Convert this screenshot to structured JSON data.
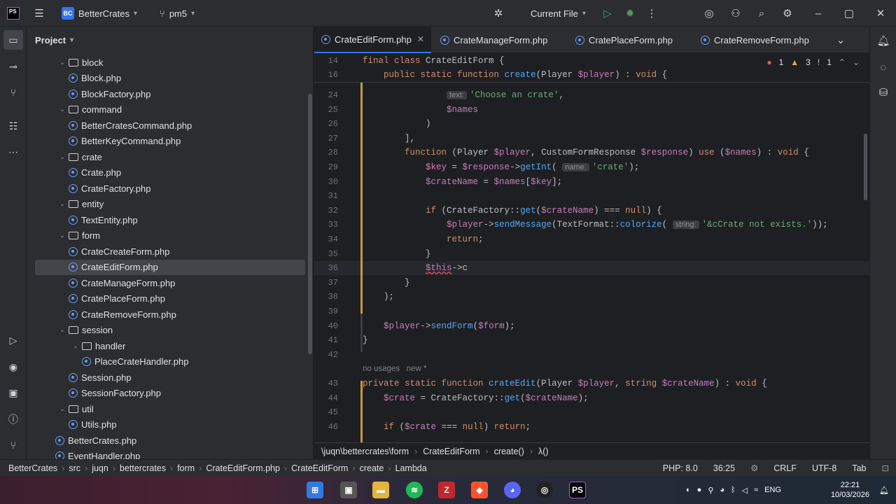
{
  "titlebar": {
    "project_badge": "BC",
    "project_name": "BetterCrates",
    "branch": "pm5",
    "run_config": "Current File"
  },
  "sidebar": {
    "header": "Project",
    "items": [
      {
        "label": "block",
        "type": "folder",
        "depth": 1,
        "open": true
      },
      {
        "label": "Block.php",
        "type": "file",
        "depth": 2
      },
      {
        "label": "BlockFactory.php",
        "type": "file",
        "depth": 2
      },
      {
        "label": "command",
        "type": "folder",
        "depth": 1,
        "open": true
      },
      {
        "label": "BetterCratesCommand.php",
        "type": "file",
        "depth": 2
      },
      {
        "label": "BetterKeyCommand.php",
        "type": "file",
        "depth": 2
      },
      {
        "label": "crate",
        "type": "folder",
        "depth": 1,
        "open": true
      },
      {
        "label": "Crate.php",
        "type": "file",
        "depth": 2
      },
      {
        "label": "CrateFactory.php",
        "type": "file",
        "depth": 2
      },
      {
        "label": "entity",
        "type": "folder",
        "depth": 1,
        "open": true
      },
      {
        "label": "TextEntity.php",
        "type": "file",
        "depth": 2
      },
      {
        "label": "form",
        "type": "folder",
        "depth": 1,
        "open": true
      },
      {
        "label": "CrateCreateForm.php",
        "type": "file",
        "depth": 2
      },
      {
        "label": "CrateEditForm.php",
        "type": "file",
        "depth": 2,
        "selected": true
      },
      {
        "label": "CrateManageForm.php",
        "type": "file",
        "depth": 2
      },
      {
        "label": "CratePlaceForm.php",
        "type": "file",
        "depth": 2
      },
      {
        "label": "CrateRemoveForm.php",
        "type": "file",
        "depth": 2
      },
      {
        "label": "session",
        "type": "folder",
        "depth": 1,
        "open": true
      },
      {
        "label": "handler",
        "type": "folder",
        "depth": 2,
        "open": true
      },
      {
        "label": "PlaceCrateHandler.php",
        "type": "file",
        "depth": 3
      },
      {
        "label": "Session.php",
        "type": "file",
        "depth": 2
      },
      {
        "label": "SessionFactory.php",
        "type": "file",
        "depth": 2
      },
      {
        "label": "util",
        "type": "folder",
        "depth": 1,
        "open": true
      },
      {
        "label": "Utils.php",
        "type": "file",
        "depth": 2
      },
      {
        "label": "BetterCrates.php",
        "type": "file",
        "depth": 1
      },
      {
        "label": "EventHandler.php",
        "type": "file",
        "depth": 1
      }
    ]
  },
  "tabs": [
    {
      "label": "CrateEditForm.php",
      "active": true
    },
    {
      "label": "CrateManageForm.php"
    },
    {
      "label": "CratePlaceForm.php"
    },
    {
      "label": "CrateRemoveForm.php"
    }
  ],
  "problems": {
    "errors": "1",
    "warnings": "3",
    "infos": "1"
  },
  "editor": {
    "sticky": [
      {
        "ln": "14",
        "html": "<span class=\"kw\">final class</span> CrateEditForm {"
      },
      {
        "ln": "16",
        "html": "    <span class=\"kw\">public static function</span> <span class=\"fn\">create</span>(Player <span class=\"var\">$player</span>) : <span class=\"kw\">void</span> {"
      }
    ],
    "lines": [
      {
        "ln": "24",
        "html": "                <span class=\"hint\">text:</span><span class=\"str\">'Choose an crate'</span>,"
      },
      {
        "ln": "25",
        "html": "                <span class=\"var\">$names</span>"
      },
      {
        "ln": "26",
        "html": "            )"
      },
      {
        "ln": "27",
        "html": "        ],"
      },
      {
        "ln": "28",
        "html": "        <span class=\"kw\">function</span> (Player <span class=\"var\">$player</span>, CustomFormResponse <span class=\"var\">$response</span>) <span class=\"kw\">use</span> (<span class=\"var\">$names</span>) : <span class=\"kw\">void</span> {"
      },
      {
        "ln": "29",
        "html": "            <span class=\"var\">$key</span> = <span class=\"var\">$response</span>-><span class=\"fn\">getInt</span>( <span class=\"hint\">name:</span><span class=\"str\">'crate'</span>);"
      },
      {
        "ln": "30",
        "html": "            <span class=\"var\">$crateName</span> = <span class=\"var\">$names</span>[<span class=\"var\">$key</span>];"
      },
      {
        "ln": "31",
        "html": ""
      },
      {
        "ln": "32",
        "html": "            <span class=\"kw\">if</span> (CrateFactory::<span class=\"fn\">get</span>(<span class=\"var\">$crateName</span>) === <span class=\"kw\">null</span>) {"
      },
      {
        "ln": "33",
        "html": "                <span class=\"var\">$player</span>-><span class=\"fn\">sendMessage</span>(TextFormat::<span class=\"fn\">colorize</span>( <span class=\"hint\">string:</span><span class=\"str\">'&amp;cCrate not exists.'</span>));"
      },
      {
        "ln": "34",
        "html": "                <span class=\"kw\">return</span>;"
      },
      {
        "ln": "35",
        "html": "            }"
      },
      {
        "ln": "36",
        "html": "            <span class=\"var\" style=\"text-decoration: underline wavy #e55765;\">$this</span>->c"
      },
      {
        "ln": "37",
        "html": "        }"
      },
      {
        "ln": "38",
        "html": "    );"
      },
      {
        "ln": "39",
        "html": ""
      },
      {
        "ln": "40",
        "html": "    <span class=\"var\">$player</span>-><span class=\"fn\">sendForm</span>(<span class=\"var\">$form</span>);"
      },
      {
        "ln": "41",
        "html": "}"
      },
      {
        "ln": "42",
        "html": ""
      },
      {
        "ln": "",
        "html": "<span class=\"meta\">no usages   new *</span>"
      },
      {
        "ln": "43",
        "html": "<span class=\"kw\">private static function</span> <span class=\"fn\">crateEdit</span>(Player <span class=\"var\">$player</span>, <span class=\"kw\">string</span> <span class=\"var\">$crateName</span>) : <span class=\"kw\">void</span> {"
      },
      {
        "ln": "44",
        "html": "    <span class=\"var\">$crate</span> = CrateFactory::<span class=\"fn\">get</span>(<span class=\"var\">$crateName</span>);"
      },
      {
        "ln": "45",
        "html": ""
      },
      {
        "ln": "46",
        "html": "    <span class=\"kw\">if</span> (<span class=\"var\">$crate</span> === <span class=\"kw\">null</span>) <span class=\"kw\">return</span>;"
      }
    ]
  },
  "crumbs": [
    "\\juqn\\bettercrates\\form",
    "CrateEditForm",
    "create()",
    "λ()"
  ],
  "statusbar": {
    "path": [
      "BetterCrates",
      "src",
      "juqn",
      "bettercrates",
      "form",
      "CrateEditForm.php",
      "CrateEditForm",
      "create",
      "Lambda"
    ],
    "php": "PHP: 8.0",
    "position": "36:25",
    "line_sep": "CRLF",
    "encoding": "UTF-8",
    "indent": "Tab"
  },
  "taskbar": {
    "lang": "ENG",
    "time": "22:21",
    "date": "10/03/2026"
  },
  "colors": {
    "accent": "#3574f0",
    "bg": "#1e1f22",
    "panel": "#2b2d30"
  }
}
